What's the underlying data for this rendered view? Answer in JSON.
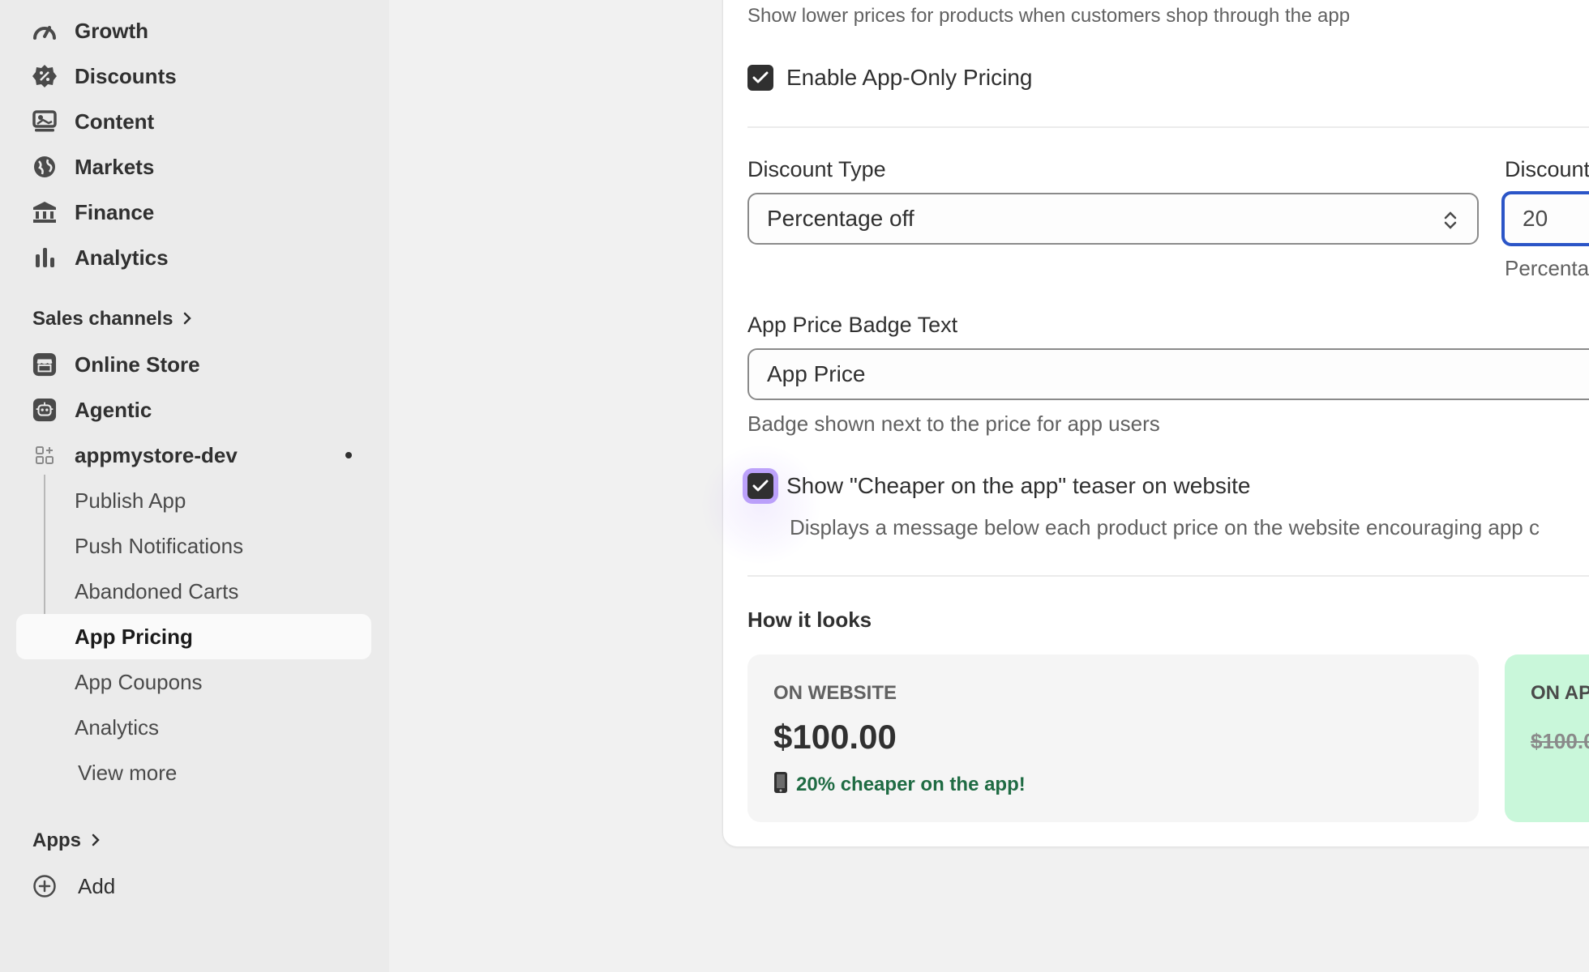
{
  "sidebar": {
    "main_items": [
      {
        "label": "Growth",
        "icon": "gauge-icon"
      },
      {
        "label": "Discounts",
        "icon": "discount-badge-icon"
      },
      {
        "label": "Content",
        "icon": "content-image-icon"
      },
      {
        "label": "Markets",
        "icon": "globe-icon"
      },
      {
        "label": "Finance",
        "icon": "bank-icon"
      },
      {
        "label": "Analytics",
        "icon": "bar-chart-icon"
      }
    ],
    "sales_channels_label": "Sales channels",
    "channels": [
      {
        "label": "Online Store",
        "icon": "store-icon"
      },
      {
        "label": "Agentic",
        "icon": "robot-icon"
      }
    ],
    "app": {
      "label": "appmystore-dev",
      "icon": "app-grid-icon",
      "sub_items": [
        {
          "label": "Publish App"
        },
        {
          "label": "Push Notifications"
        },
        {
          "label": "Abandoned Carts"
        },
        {
          "label": "App Pricing"
        },
        {
          "label": "App Coupons"
        },
        {
          "label": "Analytics"
        }
      ],
      "view_more": "View more"
    },
    "apps_label": "Apps",
    "add_label": "Add"
  },
  "settings": {
    "intro_text": "Show lower prices for products when customers shop through the app",
    "enable_label": "Enable App-Only Pricing",
    "enable_checked": true,
    "discount_type_label": "Discount Type",
    "discount_type_value": "Percentage off",
    "discount_value_label": "Discount",
    "discount_value": "20",
    "discount_value_help": "Percenta",
    "badge_label": "App Price Badge Text",
    "badge_value": "App Price",
    "badge_help": "Badge shown next to the price for app users",
    "teaser_label": "Show \"Cheaper on the app\" teaser on website",
    "teaser_checked": true,
    "teaser_help": "Displays a message below each product price on the website encouraging app c",
    "preview_heading": "How it looks",
    "website_preview": {
      "label": "ON WEBSITE",
      "price": "$100.00",
      "teaser": "20% cheaper on the app!"
    },
    "app_preview": {
      "label": "ON AP",
      "price": "$100.0"
    }
  },
  "colors": {
    "accent_focus": "#8b5cf6",
    "teaser_green": "#1f6b43",
    "app_preview_bg": "#c9f7da"
  }
}
